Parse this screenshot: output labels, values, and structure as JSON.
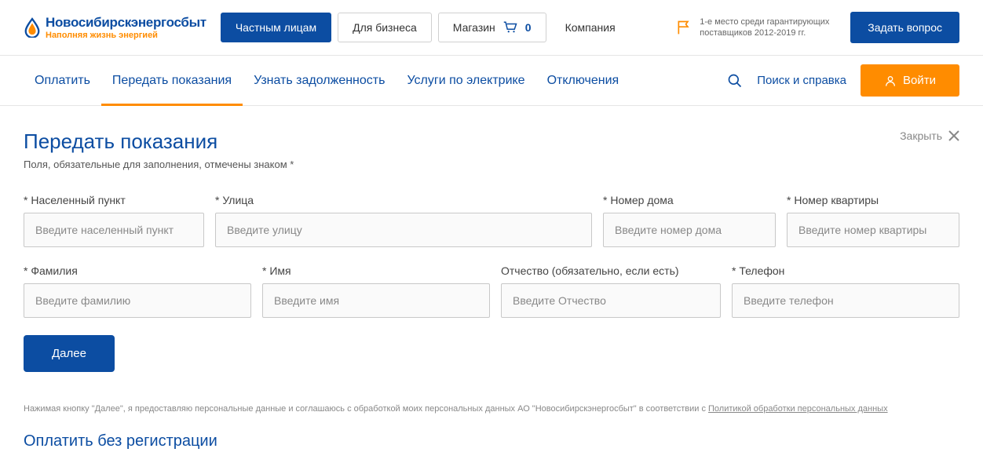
{
  "header": {
    "logo_title": "Новосибирскэнергосбыт",
    "logo_sub": "Наполняя жизнь энергией",
    "nav": {
      "private": "Частным лицам",
      "business": "Для бизнеса",
      "shop": "Магазин",
      "cart_count": "0",
      "company": "Компания"
    },
    "award": "1-е место среди гарантирующих поставщиков 2012-2019 гг.",
    "ask": "Задать вопрос"
  },
  "subnav": {
    "pay": "Оплатить",
    "submit": "Передать показания",
    "debt": "Узнать задолженность",
    "services": "Услуги по электрике",
    "outages": "Отключения",
    "search": "Поиск и справка",
    "login": "Войти"
  },
  "page": {
    "title": "Передать показания",
    "close": "Закрыть",
    "hint": "Поля, обязательные для заполнения, отмечены знаком *",
    "fields": {
      "city_label": "* Населенный пункт",
      "city_ph": "Введите населенный пункт",
      "street_label": "* Улица",
      "street_ph": "Введите улицу",
      "house_label": "* Номер дома",
      "house_ph": "Введите номер дома",
      "apt_label": "* Номер квартиры",
      "apt_ph": "Введите номер квартиры",
      "lastname_label": "* Фамилия",
      "lastname_ph": "Введите фамилию",
      "firstname_label": "* Имя",
      "firstname_ph": "Введите имя",
      "patronymic_label": "Отчество (обязательно, если есть)",
      "patronymic_ph": "Введите Отчество",
      "phone_label": "* Телефон",
      "phone_ph": "Введите телефон"
    },
    "next": "Далее",
    "consent_pre": "Нажимая кнопку \"Далее\", я предоставляю персональные данные и соглашаюсь с обработкой моих персональных данных АО \"Новосибирскэнергосбыт\" в соответствии с ",
    "consent_link": "Политикой обработки персональных данных",
    "pay_title": "Оплатить без регистрации"
  }
}
